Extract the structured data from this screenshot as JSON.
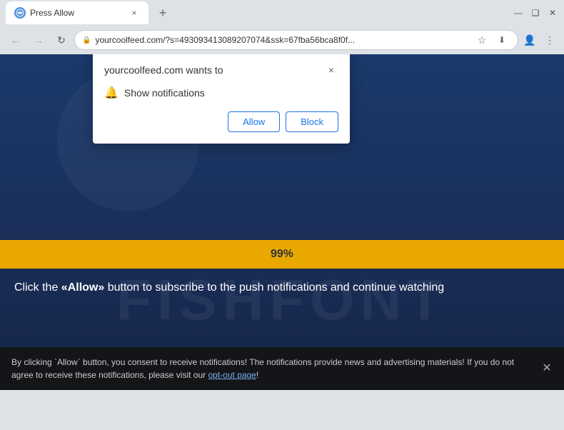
{
  "titlebar": {
    "tab_title": "Press Allow",
    "tab_close_label": "×",
    "new_tab_label": "+",
    "window_minimize": "—",
    "window_maximize": "❑",
    "window_close": "✕"
  },
  "addressbar": {
    "back_label": "←",
    "forward_label": "→",
    "refresh_label": "↻",
    "url": "yourcoolfeed.com/?s=493093413089207074&ssk=67fba56bca8f0f...",
    "lock_icon": "🔒",
    "star_icon": "☆",
    "profile_icon": "👤",
    "menu_icon": "⋮",
    "download_icon": "⬇"
  },
  "popup": {
    "title": "yourcoolfeed.com wants to",
    "close_label": "×",
    "notification_icon": "🔔",
    "notification_text": "Show notifications",
    "allow_label": "Allow",
    "block_label": "Block"
  },
  "content": {
    "progress_percent": "99%",
    "instruction": "Click the «Allow» button to subscribe to the push notifications and continue watching",
    "watermark": "FISHFONT",
    "circle_color": "rgba(255,255,255,0.04)"
  },
  "bottombar": {
    "text": "By clicking `Allow` button, you consent to receive notifications! The notifications provide news and advertising materials! If you do not agree to receive these notifications, please visit our ",
    "opt_out_label": "opt-out page",
    "text_end": "!",
    "close_label": "✕"
  }
}
